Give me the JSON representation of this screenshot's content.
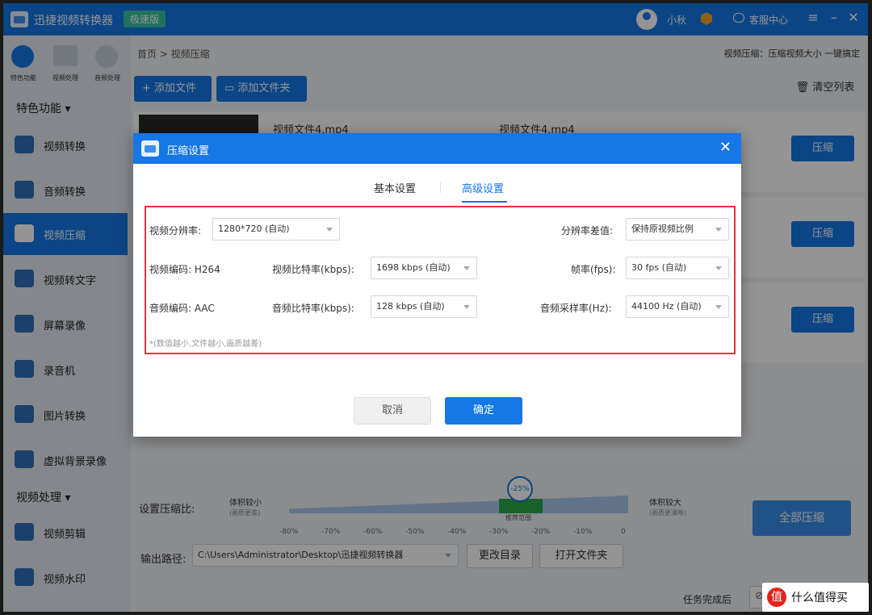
{
  "app": {
    "title": "迅捷视频转换器",
    "edition": "极速版",
    "username": "小秋",
    "message_center": "客服中心"
  },
  "top_icons": [
    {
      "label": "特色功能"
    },
    {
      "label": "视频处理"
    },
    {
      "label": "音频处理"
    }
  ],
  "sidebar": {
    "section1": "特色功能",
    "items": [
      {
        "label": "视频转换"
      },
      {
        "label": "音频转换"
      },
      {
        "label": "视频压缩"
      },
      {
        "label": "视频转文字"
      },
      {
        "label": "屏幕录像"
      },
      {
        "label": "录音机"
      },
      {
        "label": "图片转换"
      },
      {
        "label": "虚拟背景录像"
      }
    ],
    "section2": "视频处理",
    "items2": [
      {
        "label": "视频剪辑"
      },
      {
        "label": "视频水印"
      }
    ]
  },
  "header": {
    "breadcrumb": "首页 > 视频压缩",
    "slogan": "视频压缩：压缩视频大小 一键搞定",
    "add_file": "添加文件",
    "add_folder": "添加文件夹",
    "clear_list": "清空列表"
  },
  "files": [
    {
      "name": "视频文件4.mp4",
      "name2": "视频文件4.mp4",
      "action": "压缩"
    },
    {
      "name": "",
      "name2": "",
      "action": "压缩"
    },
    {
      "name": "",
      "name2": "",
      "action": "压缩"
    }
  ],
  "bottom": {
    "compression_label": "设置压缩比:",
    "smaller_label": "体积较小",
    "smaller_sub": "(画质更差)",
    "larger_label": "体积较大",
    "larger_sub": "(画质更清晰)",
    "marker": "-25%",
    "marker_sub": "推荐范围",
    "ticks": [
      "-80%",
      "-70%",
      "-60%",
      "-50%",
      "-40%",
      "-30%",
      "-20%",
      "-10%",
      "0"
    ],
    "output_label": "输出路径:",
    "output_path": "C:\\Users\\Administrator\\Desktop\\迅捷视频转换器",
    "change_dir": "更改目录",
    "open_folder": "打开文件夹",
    "compress_all": "全部压缩",
    "after_done": "任务完成后"
  },
  "dialog": {
    "title": "压缩设置",
    "tabs": [
      "基本设置",
      "高级设置"
    ],
    "active_tab": "高级设置",
    "resolution_label": "视频分辨率:",
    "resolution_value": "1280*720 (自动)",
    "interp_label": "分辨率差值:",
    "interp_value": "保持原视频比例",
    "video_codec": "视频编码: H264",
    "video_bitrate_label": "视频比特率(kbps):",
    "video_bitrate_value": "1698 kbps (自动)",
    "fps_label": "帧率(fps):",
    "fps_value": "30 fps (自动)",
    "audio_codec": "音频编码: AAC",
    "audio_bitrate_label": "音频比特率(kbps):",
    "audio_bitrate_value": "128 kbps (自动)",
    "samplerate_label": "音频采样率(Hz):",
    "samplerate_value": "44100 Hz (自动)",
    "hint": "*(数值越小,文件越小,画质越差)",
    "cancel": "取消",
    "ok": "确定"
  },
  "watermark": {
    "icon": "值",
    "text": "什么值得买"
  }
}
